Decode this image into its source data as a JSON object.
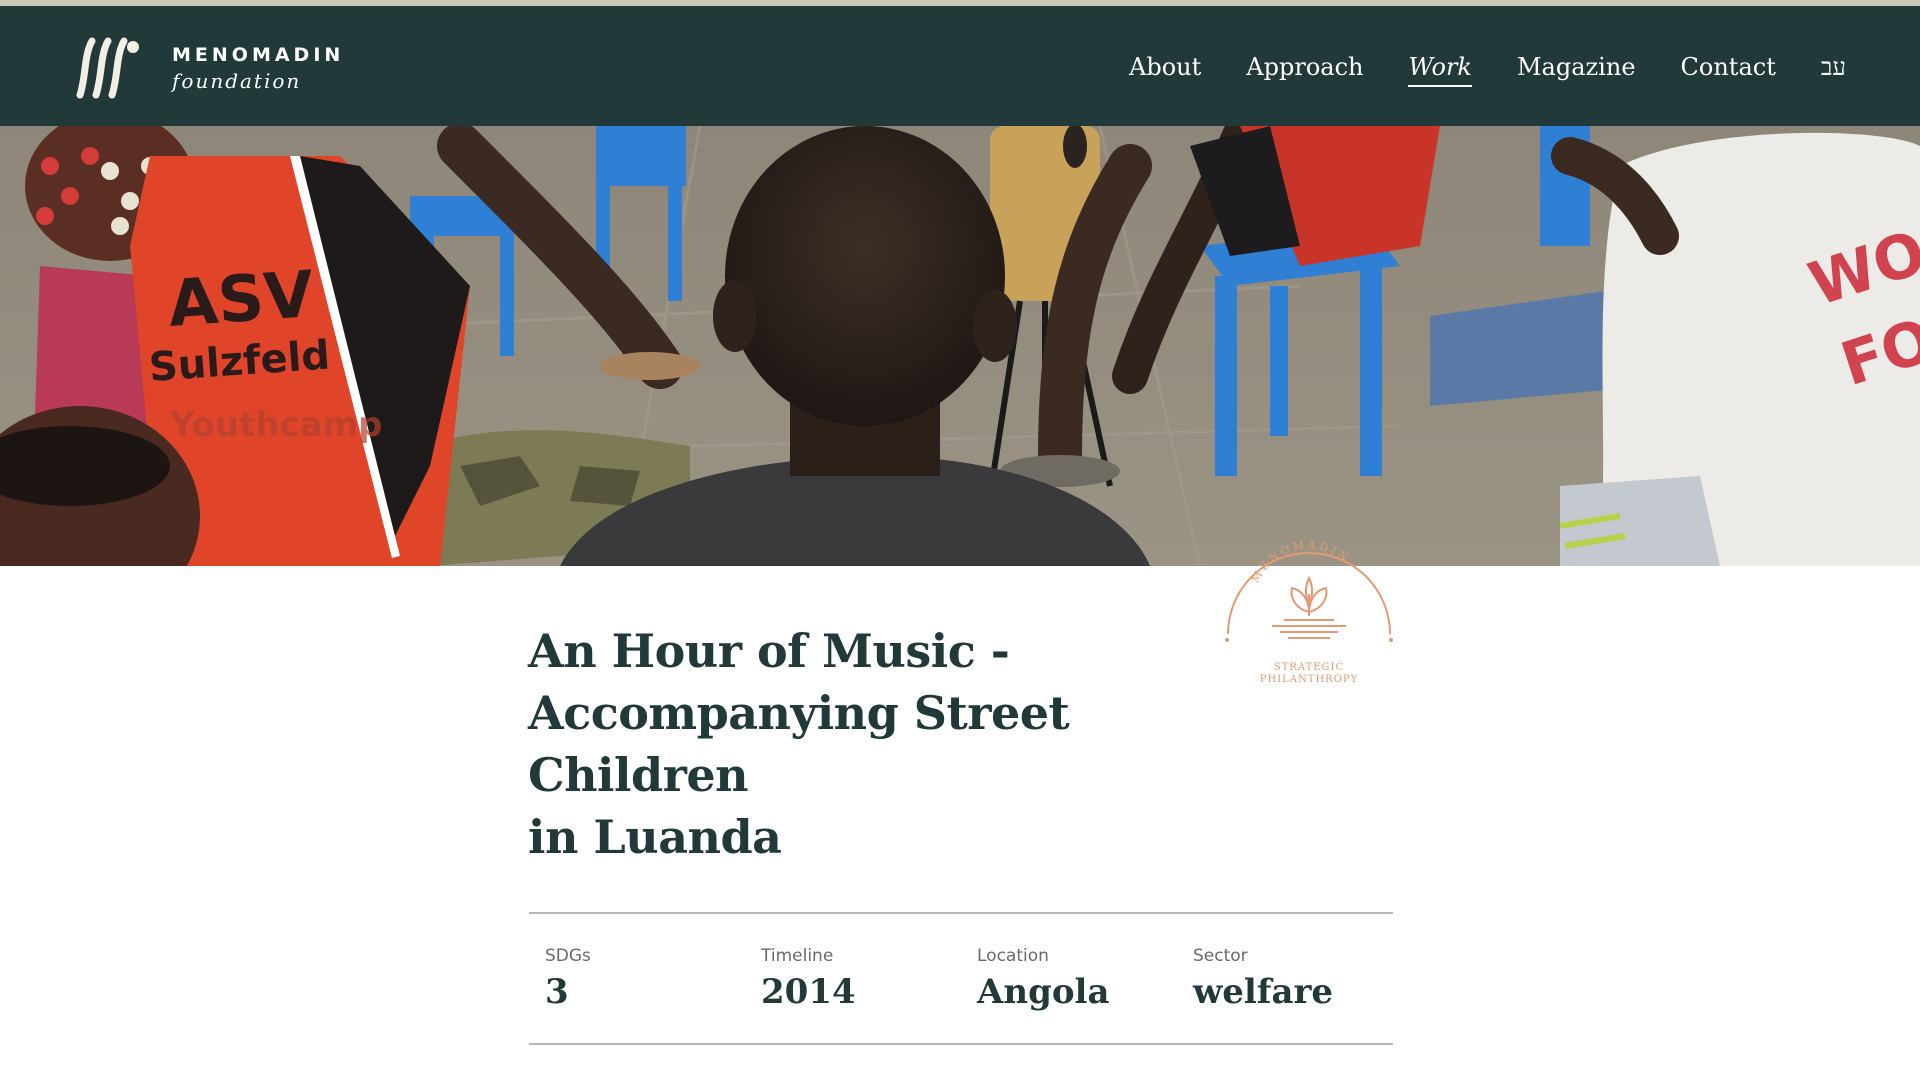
{
  "brand": {
    "name_line1": "MENOMADIN",
    "name_line2": "foundation"
  },
  "nav": {
    "items": [
      {
        "label": "About",
        "active": false
      },
      {
        "label": "Approach",
        "active": false
      },
      {
        "label": "Work",
        "active": true
      },
      {
        "label": "Magazine",
        "active": false
      },
      {
        "label": "Contact",
        "active": false
      },
      {
        "label": "עב",
        "active": false
      }
    ]
  },
  "hero": {
    "shirt_text_1": "ASV",
    "shirt_text_2": "Sulzfeld",
    "shirt_text_3": "Youthcamp",
    "shirt_text_4": "WO",
    "shirt_text_5": "FO"
  },
  "badge": {
    "arc_text": "MENOMADIN",
    "line1": "STRATEGIC",
    "line2": "PHILANTHROPY",
    "color": "#e39a73"
  },
  "article": {
    "title_line1": "An Hour of Music -",
    "title_line2": "Accompanying Street Children",
    "title_line3": "in Luanda"
  },
  "facts": [
    {
      "label": "SDGs",
      "value": "3"
    },
    {
      "label": "Timeline",
      "value": "2014"
    },
    {
      "label": "Location",
      "value": "Angola"
    },
    {
      "label": "Sector",
      "value": "welfare"
    }
  ],
  "colors": {
    "nav_bg": "#22393a",
    "title": "#22393a",
    "accent": "#e39a73"
  }
}
